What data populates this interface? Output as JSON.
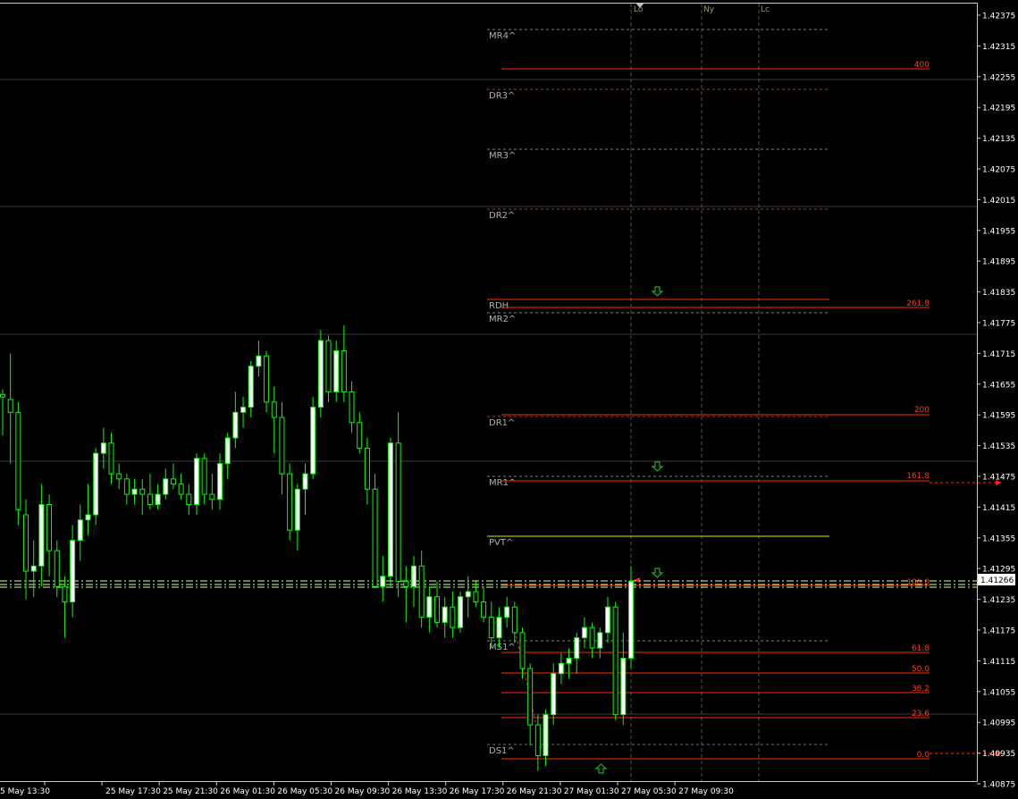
{
  "colors": {
    "background": "#000000",
    "frame": "#c8c8c8",
    "axis_text": "#ffffff",
    "candle": "#00ff00",
    "candle_body_up": "#ffffff",
    "candle_body_down": "#000000",
    "fib": "#ff2a00",
    "pivot_dash": "#707070",
    "pvt": "#e6e600",
    "session": "#999966",
    "grid_h": "#3a3a4a",
    "arrow": "#22aa22",
    "price_box_bg": "#ffffff",
    "price_box_text": "#000000"
  },
  "price_axis": {
    "labels": [
      "1.42375",
      "1.42315",
      "1.42255",
      "1.42195",
      "1.42135",
      "1.42075",
      "1.42015",
      "1.41955",
      "1.41895",
      "1.41835",
      "1.41775",
      "1.41715",
      "1.41655",
      "1.41595",
      "1.41535",
      "1.41475",
      "1.41415",
      "1.41355",
      "1.41295",
      "1.41235",
      "1.41175",
      "1.41115",
      "1.41055",
      "1.40995",
      "1.40935",
      "1.40875"
    ],
    "current_price": "1.41266"
  },
  "time_axis": {
    "labels": [
      "5 May 13:30",
      "25 May 17:30",
      "25 May 21:30",
      "26 May 01:30",
      "26 May 05:30",
      "26 May 09:30",
      "26 May 13:30",
      "26 May 17:30",
      "26 May 21:30",
      "27 May 01:30",
      "27 May 05:30",
      "27 May 09:30"
    ]
  },
  "sessions": [
    "Lo",
    "Ny",
    "Lc"
  ],
  "pivot_labels": [
    "MR4^",
    "DR3^",
    "MR3^",
    "DR2^",
    "RDH",
    "MR2^",
    "DR1^",
    "MR1^",
    "PVT^",
    "MS1^",
    "DS1^"
  ],
  "fib_labels": [
    "400",
    "261.8",
    "200",
    "161.8",
    "100.0",
    "61.8",
    "50.0",
    "38.2",
    "23.6",
    "0.0"
  ],
  "candles": [
    {
      "o": 1.41635,
      "h": 1.41645,
      "l": 1.41555,
      "c": 1.4163
    },
    {
      "o": 1.41625,
      "h": 1.41715,
      "l": 1.415,
      "c": 1.416
    },
    {
      "o": 1.416,
      "h": 1.4162,
      "l": 1.4138,
      "c": 1.4141
    },
    {
      "o": 1.414,
      "h": 1.4143,
      "l": 1.41235,
      "c": 1.4129
    },
    {
      "o": 1.4129,
      "h": 1.4135,
      "l": 1.4124,
      "c": 1.413
    },
    {
      "o": 1.413,
      "h": 1.4146,
      "l": 1.4126,
      "c": 1.4142
    },
    {
      "o": 1.4142,
      "h": 1.4144,
      "l": 1.4128,
      "c": 1.4133
    },
    {
      "o": 1.4133,
      "h": 1.4135,
      "l": 1.4124,
      "c": 1.4126
    },
    {
      "o": 1.4126,
      "h": 1.4128,
      "l": 1.4116,
      "c": 1.4123
    },
    {
      "o": 1.4123,
      "h": 1.4138,
      "l": 1.412,
      "c": 1.4135
    },
    {
      "o": 1.4135,
      "h": 1.4142,
      "l": 1.4131,
      "c": 1.4139
    },
    {
      "o": 1.4139,
      "h": 1.4146,
      "l": 1.4136,
      "c": 1.414
    },
    {
      "o": 1.414,
      "h": 1.4153,
      "l": 1.4138,
      "c": 1.4152
    },
    {
      "o": 1.4152,
      "h": 1.4157,
      "l": 1.4149,
      "c": 1.4154
    },
    {
      "o": 1.4154,
      "h": 1.4156,
      "l": 1.4146,
      "c": 1.4148
    },
    {
      "o": 1.4148,
      "h": 1.415,
      "l": 1.4145,
      "c": 1.4147
    },
    {
      "o": 1.4147,
      "h": 1.4148,
      "l": 1.4142,
      "c": 1.4144
    },
    {
      "o": 1.4144,
      "h": 1.4147,
      "l": 1.4142,
      "c": 1.4145
    },
    {
      "o": 1.4145,
      "h": 1.4147,
      "l": 1.414,
      "c": 1.4144
    },
    {
      "o": 1.4144,
      "h": 1.4148,
      "l": 1.4141,
      "c": 1.4142
    },
    {
      "o": 1.4142,
      "h": 1.4146,
      "l": 1.4141,
      "c": 1.4144
    },
    {
      "o": 1.4144,
      "h": 1.4149,
      "l": 1.4143,
      "c": 1.4147
    },
    {
      "o": 1.4147,
      "h": 1.415,
      "l": 1.4145,
      "c": 1.4146
    },
    {
      "o": 1.4146,
      "h": 1.4148,
      "l": 1.4143,
      "c": 1.4144
    },
    {
      "o": 1.4144,
      "h": 1.4146,
      "l": 1.414,
      "c": 1.4142
    },
    {
      "o": 1.4142,
      "h": 1.4152,
      "l": 1.414,
      "c": 1.4151
    },
    {
      "o": 1.4151,
      "h": 1.4152,
      "l": 1.4142,
      "c": 1.4144
    },
    {
      "o": 1.4144,
      "h": 1.4148,
      "l": 1.4141,
      "c": 1.4143
    },
    {
      "o": 1.4143,
      "h": 1.4152,
      "l": 1.4141,
      "c": 1.415
    },
    {
      "o": 1.415,
      "h": 1.4156,
      "l": 1.4147,
      "c": 1.4155
    },
    {
      "o": 1.4155,
      "h": 1.4164,
      "l": 1.4153,
      "c": 1.416
    },
    {
      "o": 1.416,
      "h": 1.4163,
      "l": 1.4157,
      "c": 1.4161
    },
    {
      "o": 1.4161,
      "h": 1.417,
      "l": 1.4159,
      "c": 1.4169
    },
    {
      "o": 1.4169,
      "h": 1.4174,
      "l": 1.4167,
      "c": 1.4171
    },
    {
      "o": 1.4171,
      "h": 1.4172,
      "l": 1.416,
      "c": 1.4162
    },
    {
      "o": 1.4162,
      "h": 1.4165,
      "l": 1.4152,
      "c": 1.4159
    },
    {
      "o": 1.4159,
      "h": 1.4162,
      "l": 1.4144,
      "c": 1.4148
    },
    {
      "o": 1.4148,
      "h": 1.415,
      "l": 1.4135,
      "c": 1.4137
    },
    {
      "o": 1.4137,
      "h": 1.4146,
      "l": 1.4133,
      "c": 1.4145
    },
    {
      "o": 1.4145,
      "h": 1.415,
      "l": 1.414,
      "c": 1.4148
    },
    {
      "o": 1.4148,
      "h": 1.4163,
      "l": 1.4147,
      "c": 1.4161
    },
    {
      "o": 1.4161,
      "h": 1.4176,
      "l": 1.4159,
      "c": 1.4174
    },
    {
      "o": 1.4174,
      "h": 1.4175,
      "l": 1.4162,
      "c": 1.4164
    },
    {
      "o": 1.4164,
      "h": 1.4174,
      "l": 1.4162,
      "c": 1.4172
    },
    {
      "o": 1.4172,
      "h": 1.4177,
      "l": 1.4162,
      "c": 1.4164
    },
    {
      "o": 1.4164,
      "h": 1.4166,
      "l": 1.4156,
      "c": 1.4158
    },
    {
      "o": 1.4158,
      "h": 1.416,
      "l": 1.4152,
      "c": 1.4153
    },
    {
      "o": 1.4153,
      "h": 1.4155,
      "l": 1.4142,
      "c": 1.4145
    },
    {
      "o": 1.4145,
      "h": 1.4148,
      "l": 1.4129,
      "c": 1.4126
    },
    {
      "o": 1.4126,
      "h": 1.4132,
      "l": 1.4123,
      "c": 1.4128
    },
    {
      "o": 1.4128,
      "h": 1.4155,
      "l": 1.4126,
      "c": 1.4154
    },
    {
      "o": 1.4154,
      "h": 1.416,
      "l": 1.4124,
      "c": 1.4127
    },
    {
      "o": 1.4127,
      "h": 1.413,
      "l": 1.4119,
      "c": 1.4126
    },
    {
      "o": 1.4126,
      "h": 1.4132,
      "l": 1.4122,
      "c": 1.413
    },
    {
      "o": 1.413,
      "h": 1.4133,
      "l": 1.4118,
      "c": 1.412
    },
    {
      "o": 1.412,
      "h": 1.4126,
      "l": 1.4117,
      "c": 1.4124
    },
    {
      "o": 1.4124,
      "h": 1.4127,
      "l": 1.4118,
      "c": 1.4119
    },
    {
      "o": 1.4119,
      "h": 1.4124,
      "l": 1.4116,
      "c": 1.4122
    },
    {
      "o": 1.4122,
      "h": 1.4125,
      "l": 1.4116,
      "c": 1.4118
    },
    {
      "o": 1.4118,
      "h": 1.4125,
      "l": 1.4117,
      "c": 1.4124
    },
    {
      "o": 1.4124,
      "h": 1.4128,
      "l": 1.412,
      "c": 1.4125
    },
    {
      "o": 1.4125,
      "h": 1.4127,
      "l": 1.4122,
      "c": 1.4123
    },
    {
      "o": 1.4123,
      "h": 1.4126,
      "l": 1.4119,
      "c": 1.412
    },
    {
      "o": 1.412,
      "h": 1.4123,
      "l": 1.4114,
      "c": 1.4116
    },
    {
      "o": 1.4116,
      "h": 1.4122,
      "l": 1.4114,
      "c": 1.412
    },
    {
      "o": 1.412,
      "h": 1.4124,
      "l": 1.4118,
      "c": 1.4122
    },
    {
      "o": 1.4122,
      "h": 1.4123,
      "l": 1.4115,
      "c": 1.4117
    },
    {
      "o": 1.4117,
      "h": 1.4118,
      "l": 1.4108,
      "c": 1.411
    },
    {
      "o": 1.411,
      "h": 1.4111,
      "l": 1.4095,
      "c": 1.4099
    },
    {
      "o": 1.4099,
      "h": 1.4101,
      "l": 1.409,
      "c": 1.4093
    },
    {
      "o": 1.4093,
      "h": 1.4102,
      "l": 1.4091,
      "c": 1.4101
    },
    {
      "o": 1.4101,
      "h": 1.4111,
      "l": 1.4099,
      "c": 1.4109
    },
    {
      "o": 1.4109,
      "h": 1.4113,
      "l": 1.4107,
      "c": 1.4111
    },
    {
      "o": 1.4111,
      "h": 1.4114,
      "l": 1.4108,
      "c": 1.4112
    },
    {
      "o": 1.4112,
      "h": 1.4117,
      "l": 1.4109,
      "c": 1.4116
    },
    {
      "o": 1.4116,
      "h": 1.412,
      "l": 1.4114,
      "c": 1.4118
    },
    {
      "o": 1.4118,
      "h": 1.4119,
      "l": 1.4112,
      "c": 1.4114
    },
    {
      "o": 1.4114,
      "h": 1.4118,
      "l": 1.4112,
      "c": 1.4117
    },
    {
      "o": 1.4117,
      "h": 1.4124,
      "l": 1.4115,
      "c": 1.4122
    },
    {
      "o": 1.4122,
      "h": 1.4123,
      "l": 1.41,
      "c": 1.4101
    },
    {
      "o": 1.4101,
      "h": 1.4117,
      "l": 1.4099,
      "c": 1.4112
    },
    {
      "o": 1.4112,
      "h": 1.413,
      "l": 1.411,
      "c": 1.4127
    }
  ]
}
